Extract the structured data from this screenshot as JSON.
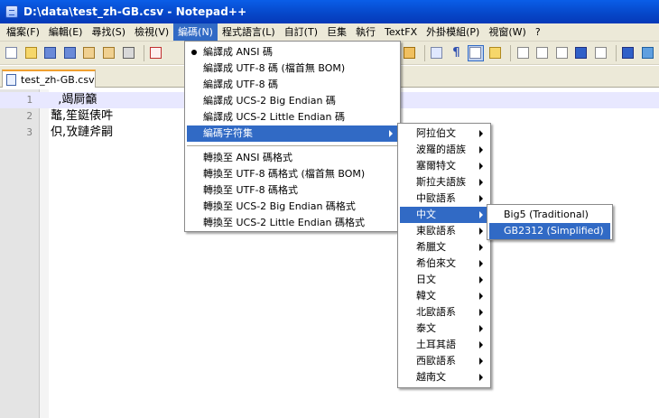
{
  "window": {
    "title": "D:\\data\\test_zh-GB.csv - Notepad++"
  },
  "menubar": [
    "檔案(F)",
    "編輯(E)",
    "尋找(S)",
    "檢視(V)",
    "編碼(N)",
    "程式語言(L)",
    "自訂(T)",
    "巨集",
    "執行",
    "TextFX",
    "外掛模組(P)",
    "視窗(W)",
    "?"
  ],
  "tab": {
    "name": "test_zh-GB.csv"
  },
  "editor": {
    "lines": [
      {
        "num": "1",
        "text": "  ,竭屙籲"
      },
      {
        "num": "2",
        "text": "鼇,笙鋌俵吽"
      },
      {
        "num": "3",
        "text": "伿,攷蹥斧嗣"
      }
    ]
  },
  "encoding_menu": {
    "items": [
      "編譯成 ANSI 碼",
      "編譯成 UTF-8 碼 (檔首無 BOM)",
      "編譯成 UTF-8 碼",
      "編譯成 UCS-2 Big Endian 碼",
      "編譯成 UCS-2 Little Endian 碼",
      "編碼字符集"
    ],
    "convert_items": [
      "轉換至 ANSI 碼格式",
      "轉換至 UTF-8 碼格式 (檔首無 BOM)",
      "轉換至 UTF-8 碼格式",
      "轉換至 UCS-2 Big Endian 碼格式",
      "轉換至 UCS-2 Little Endian 碼格式"
    ]
  },
  "charset_menu": {
    "items": [
      "阿拉伯文",
      "波羅的語族",
      "塞爾特文",
      "斯拉夫語族",
      "中歐語系",
      "中文",
      "東歐語系",
      "希臘文",
      "希伯來文",
      "日文",
      "韓文",
      "北歐語系",
      "泰文",
      "土耳其語",
      "西歐語系",
      "越南文"
    ]
  },
  "chinese_menu": {
    "items": [
      "Big5 (Traditional)",
      "GB2312 (Simplified)"
    ]
  },
  "colors": {
    "titlebar": "#0a5ee8",
    "highlight": "#316ac5",
    "chrome": "#ece9d8"
  }
}
